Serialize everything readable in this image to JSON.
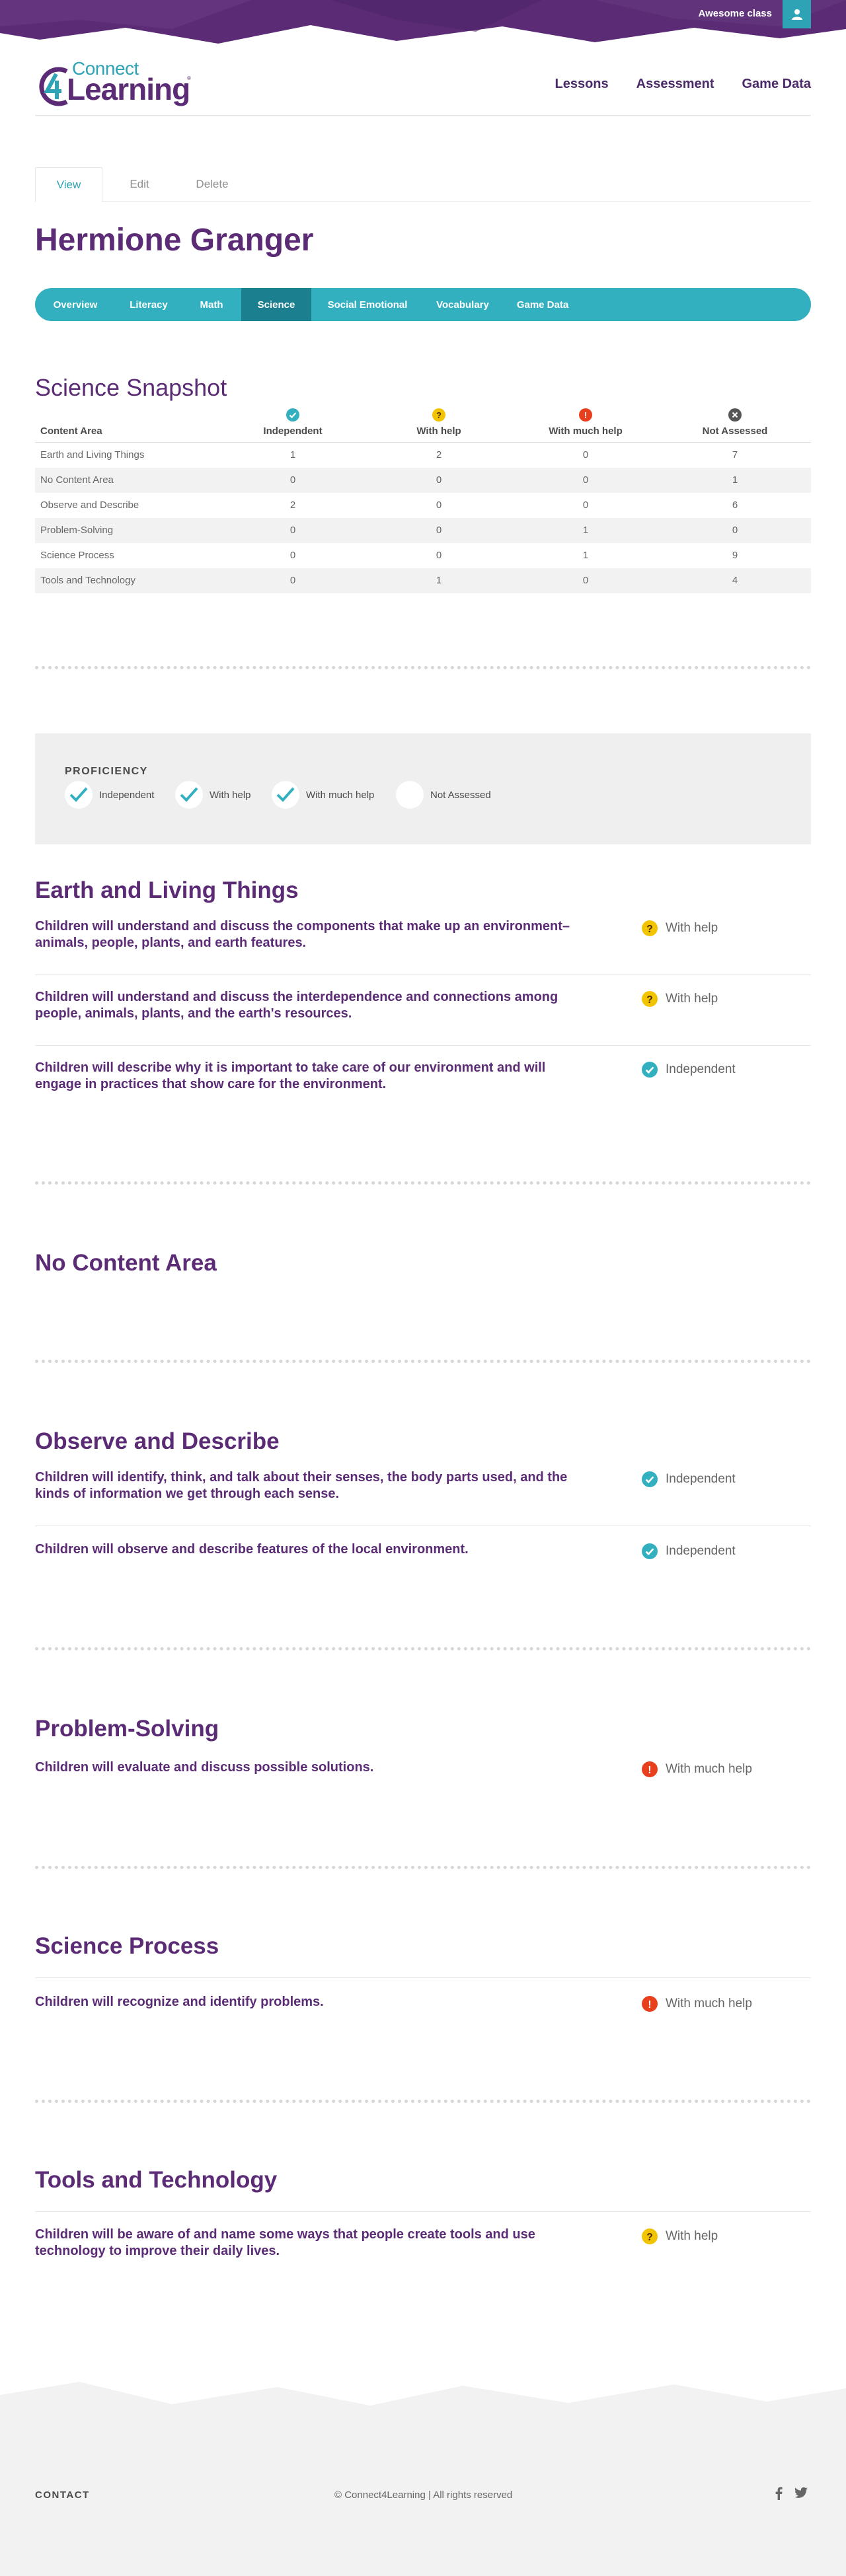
{
  "header": {
    "class_name": "Awesome class",
    "logo_connect": "Connect",
    "logo_learning": "Learning",
    "logo_tm": "®",
    "nav": [
      "Lessons",
      "Assessment",
      "Game Data"
    ]
  },
  "actions": {
    "view": "View",
    "edit": "Edit",
    "delete": "Delete"
  },
  "student_name": "Hermione Granger",
  "domain_tabs": [
    "Overview",
    "Literacy",
    "Math",
    "Science",
    "Social Emotional",
    "Vocabulary",
    "Game Data"
  ],
  "active_domain": "Science",
  "snapshot": {
    "title": "Science Snapshot",
    "columns": [
      "Content Area",
      "Independent",
      "With help",
      "With much help",
      "Not Assessed"
    ],
    "rows": [
      [
        "Earth and Living Things",
        "1",
        "2",
        "0",
        "7"
      ],
      [
        "No Content Area",
        "0",
        "0",
        "0",
        "1"
      ],
      [
        "Observe and Describe",
        "2",
        "0",
        "0",
        "6"
      ],
      [
        "Problem-Solving",
        "0",
        "0",
        "1",
        "0"
      ],
      [
        "Science Process",
        "0",
        "0",
        "1",
        "9"
      ],
      [
        "Tools and Technology",
        "0",
        "1",
        "0",
        "4"
      ]
    ]
  },
  "legend": {
    "title": "PROFICIENCY",
    "items": [
      "Independent",
      "With help",
      "With much help",
      "Not Assessed"
    ]
  },
  "areas": [
    {
      "title": "Earth and Living Things",
      "items": [
        {
          "text": "Children will understand and discuss the components that make up an environment– animals, people, plants, and earth features.",
          "status": "With help"
        },
        {
          "text": "Children will understand and discuss the interdependence and connections among people, animals, plants, and the earth's resources.",
          "status": "With help"
        },
        {
          "text": "Children will describe why it is important to take care of our environment and will engage in practices that show care for the environment.",
          "status": "Independent"
        }
      ]
    },
    {
      "title": "No Content Area",
      "items": []
    },
    {
      "title": "Observe and Describe",
      "items": [
        {
          "text": "Children will identify, think, and talk about their senses, the body parts used, and the kinds of information we get through each sense.",
          "status": "Independent"
        },
        {
          "text": "Children will observe and describe features of the local environment.",
          "status": "Independent"
        }
      ]
    },
    {
      "title": "Problem-Solving",
      "items": [
        {
          "text": "Children will evaluate and discuss possible solutions.",
          "status": "With much help"
        }
      ]
    },
    {
      "title": "Science Process",
      "items": [
        {
          "text": "Children will recognize and identify problems.",
          "status": "With much help"
        }
      ]
    },
    {
      "title": "Tools and Technology",
      "items": [
        {
          "text": "Children will be aware of and name some ways that people create tools and use technology to improve their daily lives.",
          "status": "With help"
        }
      ]
    }
  ],
  "footer": {
    "contact": "CONTACT",
    "copyright": "© Connect4Learning | All rights reserved"
  },
  "colors": {
    "brand_purple": "#5b2c75",
    "teal": "#33b0c0",
    "independent": "#33b0c0",
    "with_help": "#f2c400",
    "with_much_help": "#e8401c",
    "not_assessed": "#555555"
  },
  "icons": {
    "independent": "check-circle-icon",
    "with_help": "question-circle-icon",
    "with_much_help": "exclamation-circle-icon",
    "not_assessed": "x-circle-icon",
    "user": "user-icon",
    "facebook": "facebook-icon",
    "twitter": "twitter-icon"
  }
}
